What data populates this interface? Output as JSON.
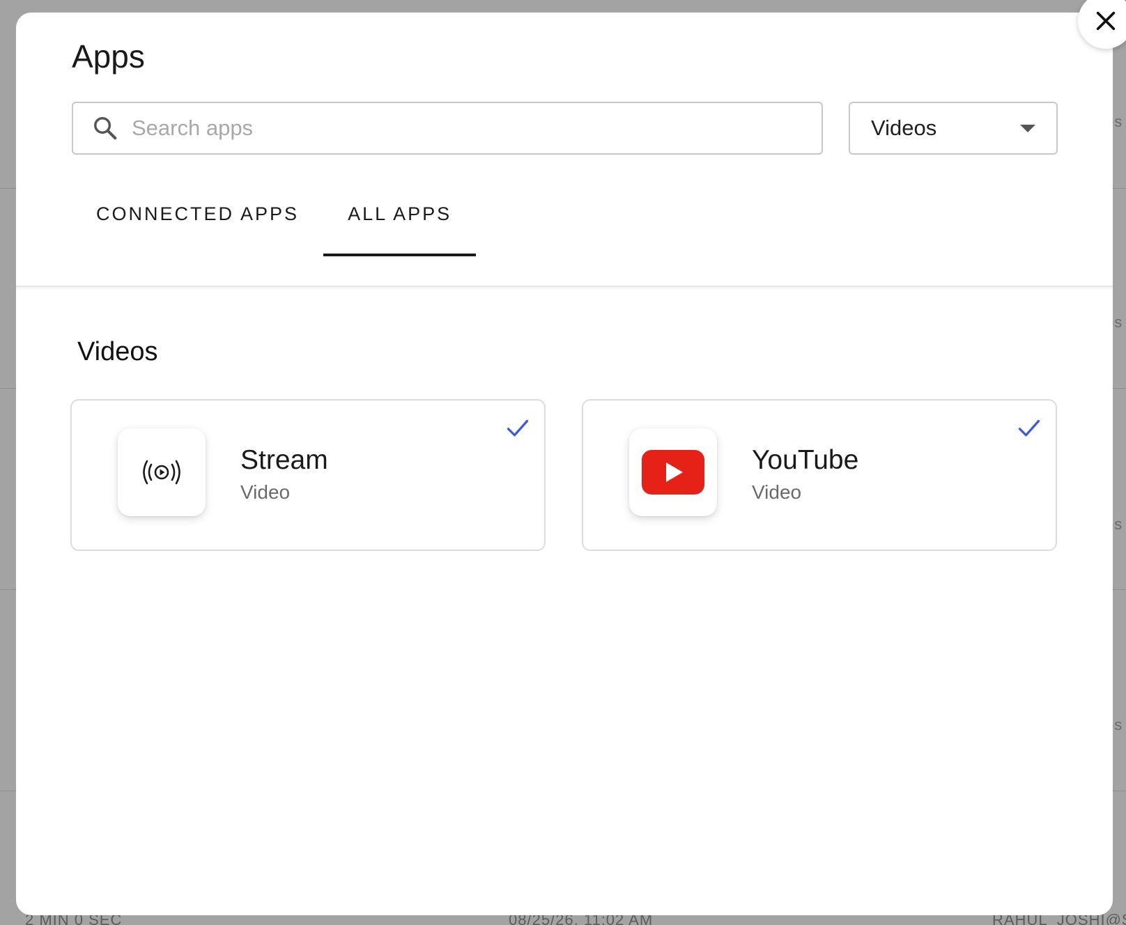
{
  "modal": {
    "title": "Apps",
    "search": {
      "placeholder": "Search apps",
      "value": ""
    },
    "category_select": {
      "selected": "Videos"
    },
    "tabs": [
      {
        "label": "CONNECTED APPS",
        "active": false
      },
      {
        "label": "ALL APPS",
        "active": true
      }
    ],
    "section_title": "Videos",
    "apps": [
      {
        "name": "Stream",
        "type": "Video",
        "icon": "stream-broadcast-icon",
        "selected": true
      },
      {
        "name": "YouTube",
        "type": "Video",
        "icon": "youtube-logo-icon",
        "selected": true
      }
    ]
  },
  "background": {
    "side_text": "os",
    "bottom_row": [
      "2 MIN 0 SEC",
      "08/25/26, 11:02 AM",
      "RAHUL_JOSHI@S"
    ]
  },
  "colors": {
    "check": "#3b5bdb",
    "youtube_red": "#e62117",
    "tab_indicator": "#1a1a1a"
  }
}
